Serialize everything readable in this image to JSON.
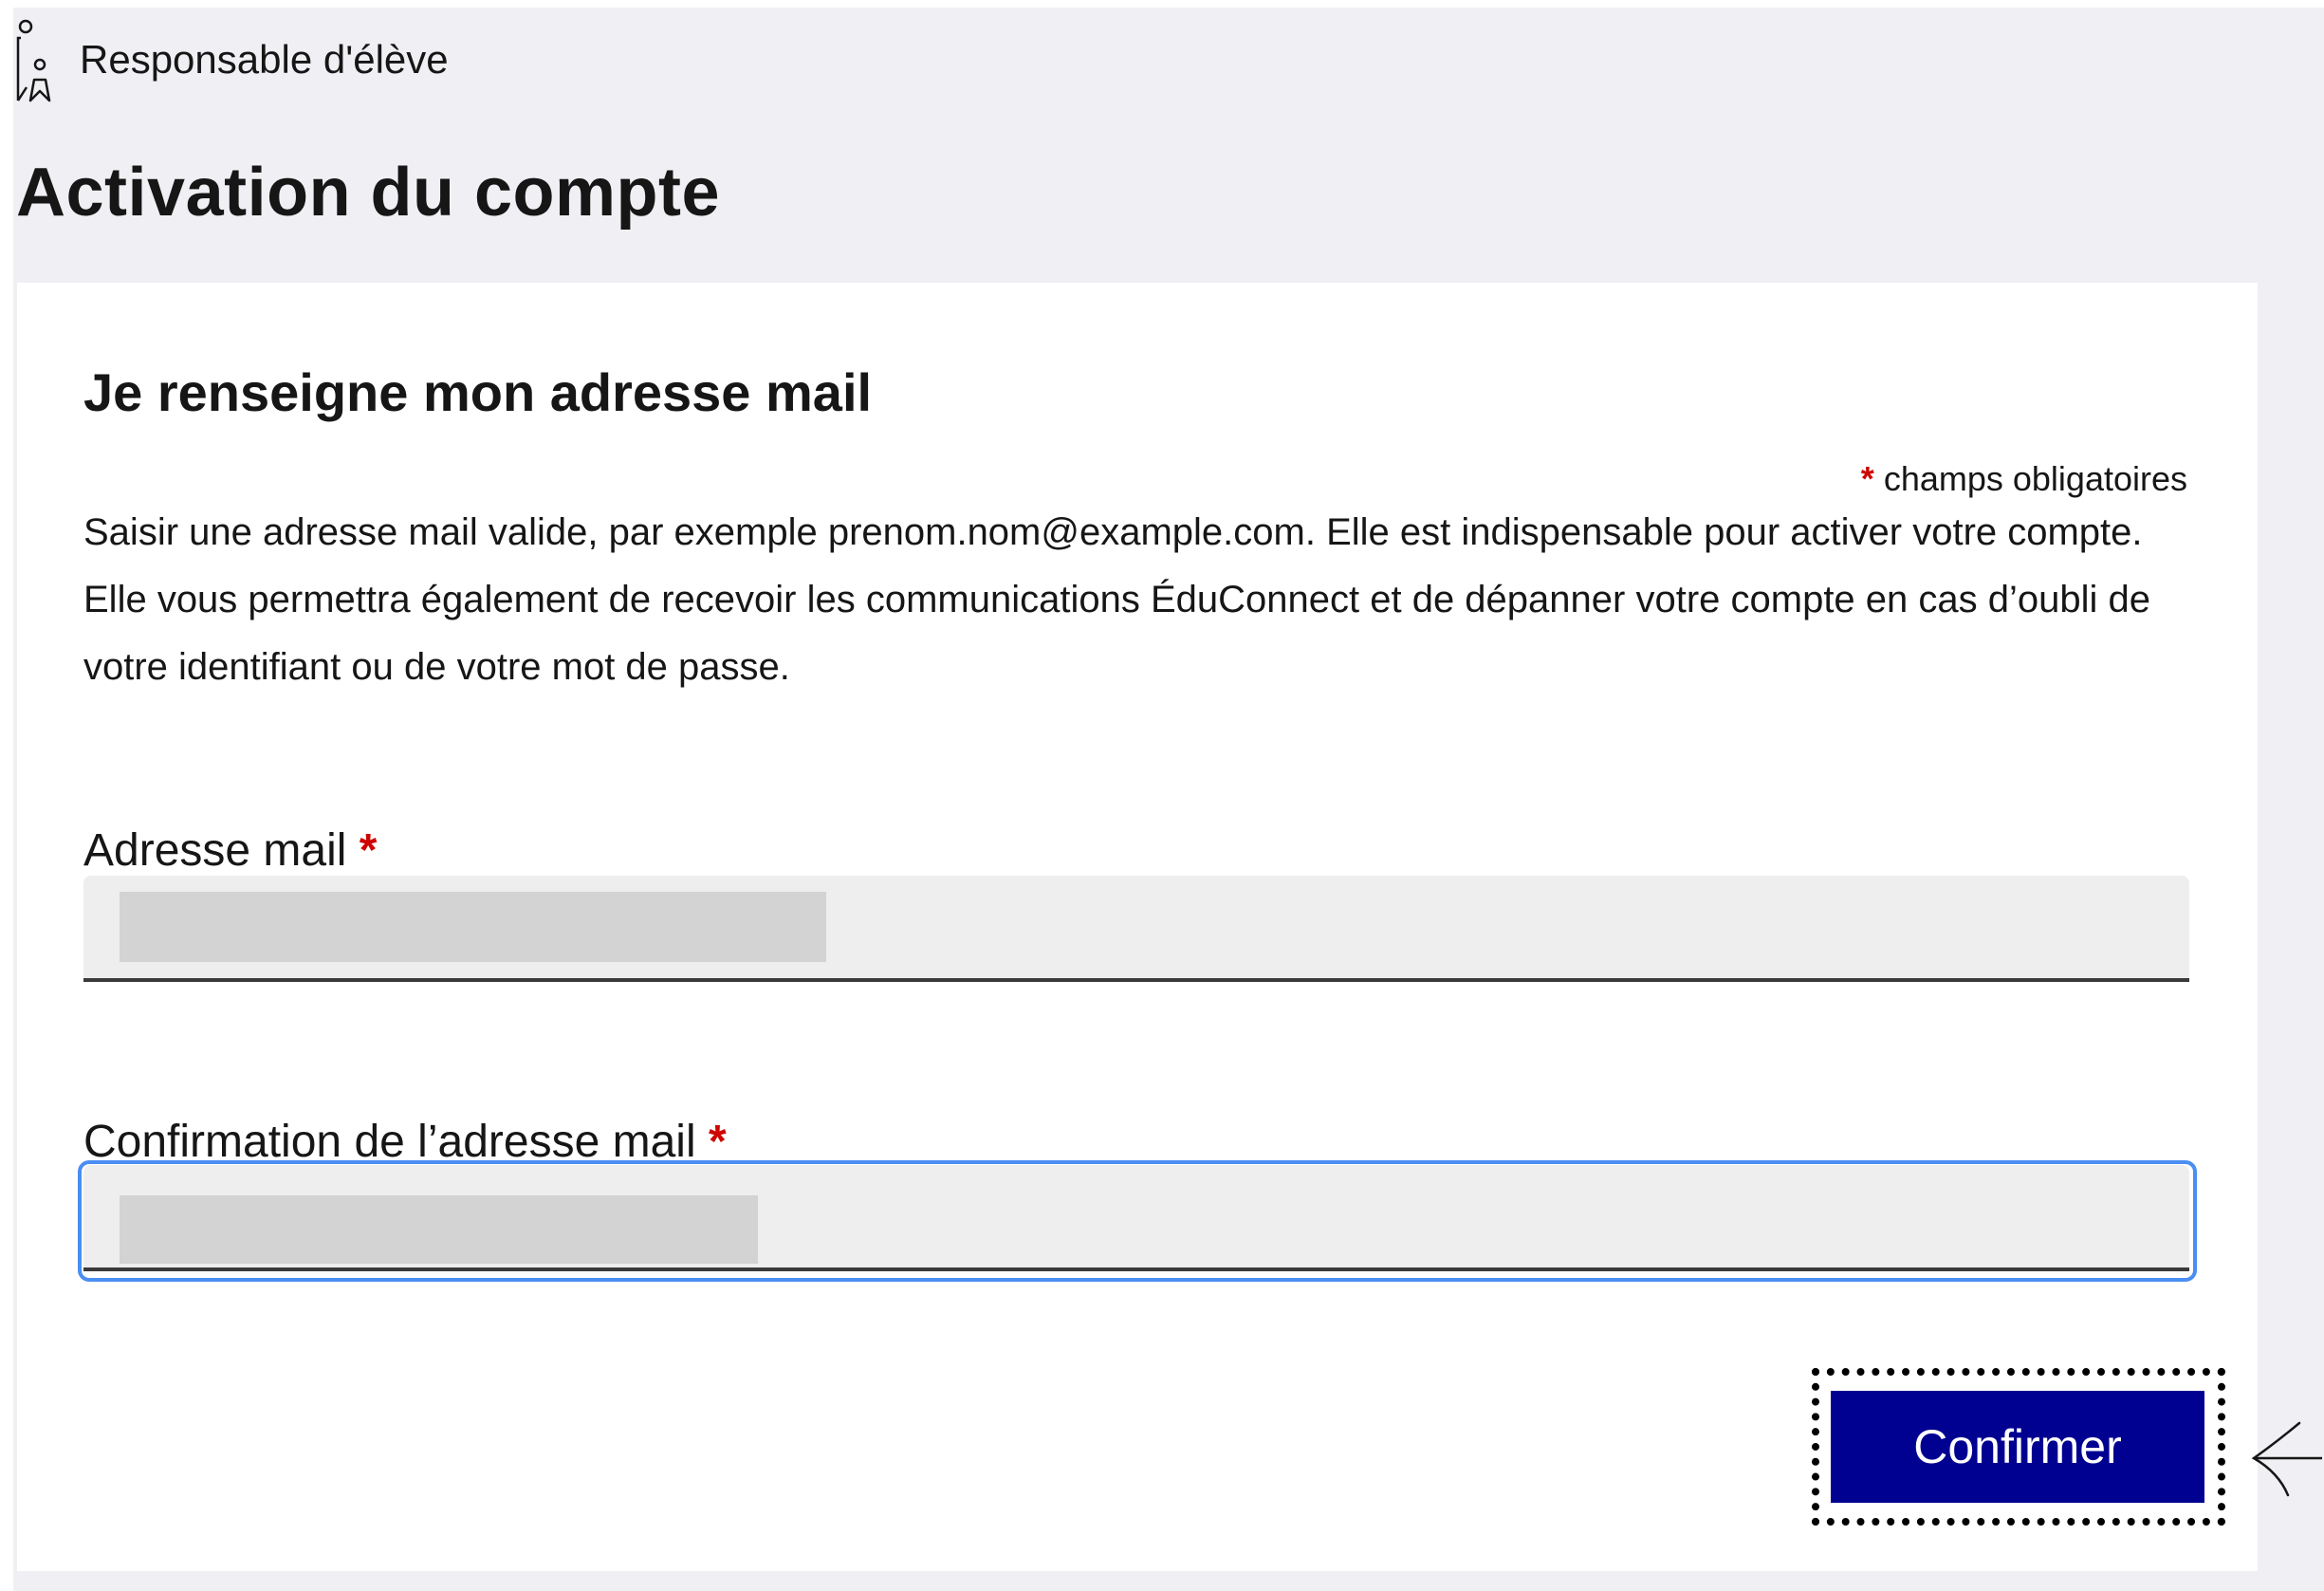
{
  "header": {
    "role_label": "Responsable d'élève",
    "role_icon": "person-bookmark-icon"
  },
  "page": {
    "title": "Activation du compte"
  },
  "card": {
    "title": "Je renseigne mon adresse mail",
    "required_star": "*",
    "required_note": "champs obligatoires",
    "description": "Saisir une adresse mail valide, par exemple prenom.nom@example.com. Elle est indispensable pour activer votre compte. Elle vous permettra également de recevoir les communications ÉduConnect et de dépanner votre compte en cas d’oubli de votre identifiant ou de votre mot de passe."
  },
  "form": {
    "email": {
      "label": "Adresse mail",
      "required_star": "*",
      "value": ""
    },
    "confirm_email": {
      "label": "Confirmation de l’adresse mail",
      "required_star": "*",
      "value": "",
      "focused": true
    },
    "submit_label": "Confirmer"
  },
  "colors": {
    "primary": "#000091",
    "required": "#ce0500",
    "background": "#f0f0f4",
    "focus": "#4a8ef2"
  }
}
